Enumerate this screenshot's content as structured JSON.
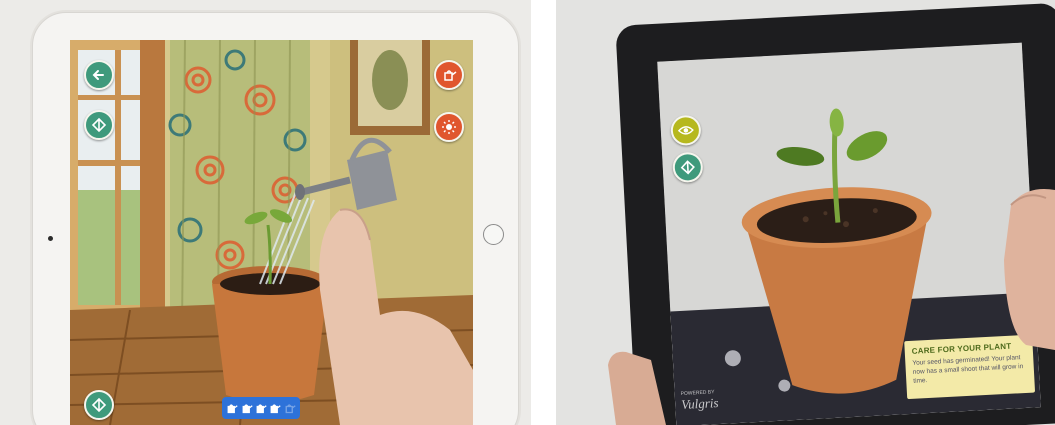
{
  "left_app": {
    "tool_buttons": [
      {
        "name": "back",
        "icon": "arrow-left-icon",
        "color": "#3f9a7c"
      },
      {
        "name": "ar-mode",
        "icon": "cube-icon",
        "color": "#3f9a7c"
      },
      {
        "name": "watering-can",
        "icon": "watering-can-icon",
        "color": "#e0562e"
      },
      {
        "name": "sun",
        "icon": "sun-icon",
        "color": "#e0562e"
      },
      {
        "name": "bottom-ar-mode",
        "icon": "cube-icon",
        "color": "#3f9a7c"
      }
    ],
    "water_level": {
      "icon": "watering-can-icon",
      "filled": 4,
      "total": 5,
      "color": "#2d72d9"
    }
  },
  "right_app": {
    "tool_buttons": [
      {
        "name": "view",
        "icon": "eye-icon",
        "color": "#b6b81e"
      },
      {
        "name": "ar-mode",
        "icon": "cube-icon",
        "color": "#3f9a7c"
      }
    ],
    "info_card": {
      "title": "CARE FOR YOUR PLANT",
      "body": "Your seed has germinated! Your plant now has a small shoot that will grow in time.",
      "background": "#f3eaa8"
    },
    "branding": {
      "powered_by": "POWERED BY",
      "brand": "Vulgris"
    }
  }
}
